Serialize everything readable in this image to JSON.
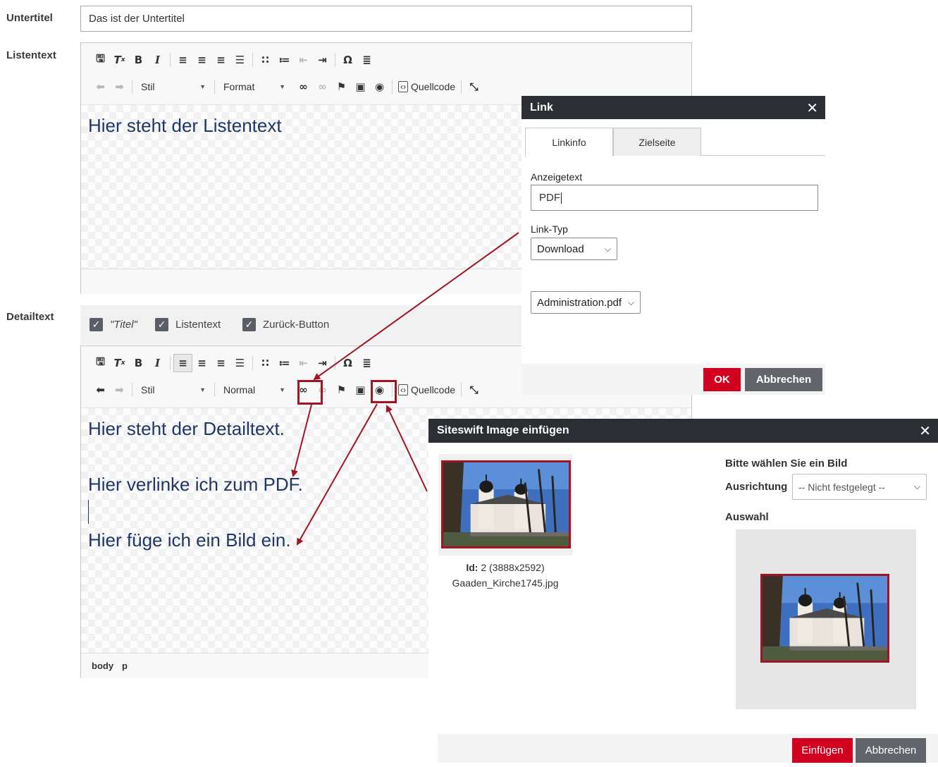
{
  "form": {
    "untertitel_label": "Untertitel",
    "untertitel_value": "Das ist der Untertitel",
    "listentext_label": "Listentext",
    "detailtext_label": "Detailtext"
  },
  "editor1": {
    "style_combo": "Stil",
    "format_combo": "Format",
    "source_label": "Quellcode",
    "content": "Hier steht der Listentext"
  },
  "editor2": {
    "options": [
      {
        "label": "\"Titel\"",
        "italic": true,
        "checked": true
      },
      {
        "label": "Listentext",
        "checked": true
      },
      {
        "label": "Zurück-Button",
        "checked": true
      }
    ],
    "style_combo": "Stil",
    "format_combo": "Normal",
    "source_label": "Quellcode",
    "lines": [
      "Hier steht der Detailtext.",
      "Hier verlinke ich zum PDF.",
      "Hier füge ich ein Bild ein."
    ],
    "path": [
      "body",
      "p"
    ]
  },
  "link_dialog": {
    "title": "Link",
    "tabs": [
      "Linkinfo",
      "Zielseite"
    ],
    "display_text_label": "Anzeigetext",
    "display_text_value": "PDF",
    "link_type_label": "Link-Typ",
    "link_type_value": "Download",
    "file_value": "Administration.pdf",
    "ok_label": "OK",
    "cancel_label": "Abbrechen"
  },
  "image_dialog": {
    "title": "Siteswift Image einfügen",
    "image_id_label": "Id:",
    "image_id_value": "2 (3888x2592)",
    "image_filename": "Gaaden_Kirche1745.jpg",
    "choose_heading": "Bitte wählen Sie ein Bild",
    "alignment_label": "Ausrichtung",
    "alignment_value": "-- Nicht festgelegt --",
    "selection_label": "Auswahl",
    "insert_label": "Einfügen",
    "cancel_label": "Abbrechen"
  },
  "colors": {
    "accent_red": "#d2001f",
    "highlight_red": "#a01523",
    "dialog_header": "#2b2e33",
    "editor_text": "#1e3766"
  },
  "icons": [
    "save-icon",
    "remove-format-icon",
    "bold-icon",
    "italic-icon",
    "align-left-icon",
    "align-center-icon",
    "align-right-icon",
    "justify-icon",
    "bulleted-list-icon",
    "numbered-list-icon",
    "outdent-icon",
    "indent-icon",
    "special-char-icon",
    "horizontal-line-icon",
    "undo-icon",
    "redo-icon",
    "link-icon",
    "unlink-icon",
    "anchor-flag-icon",
    "image-icon",
    "media-icon",
    "source-icon",
    "maximize-icon",
    "close-icon",
    "check-icon",
    "chevron-down-icon"
  ]
}
